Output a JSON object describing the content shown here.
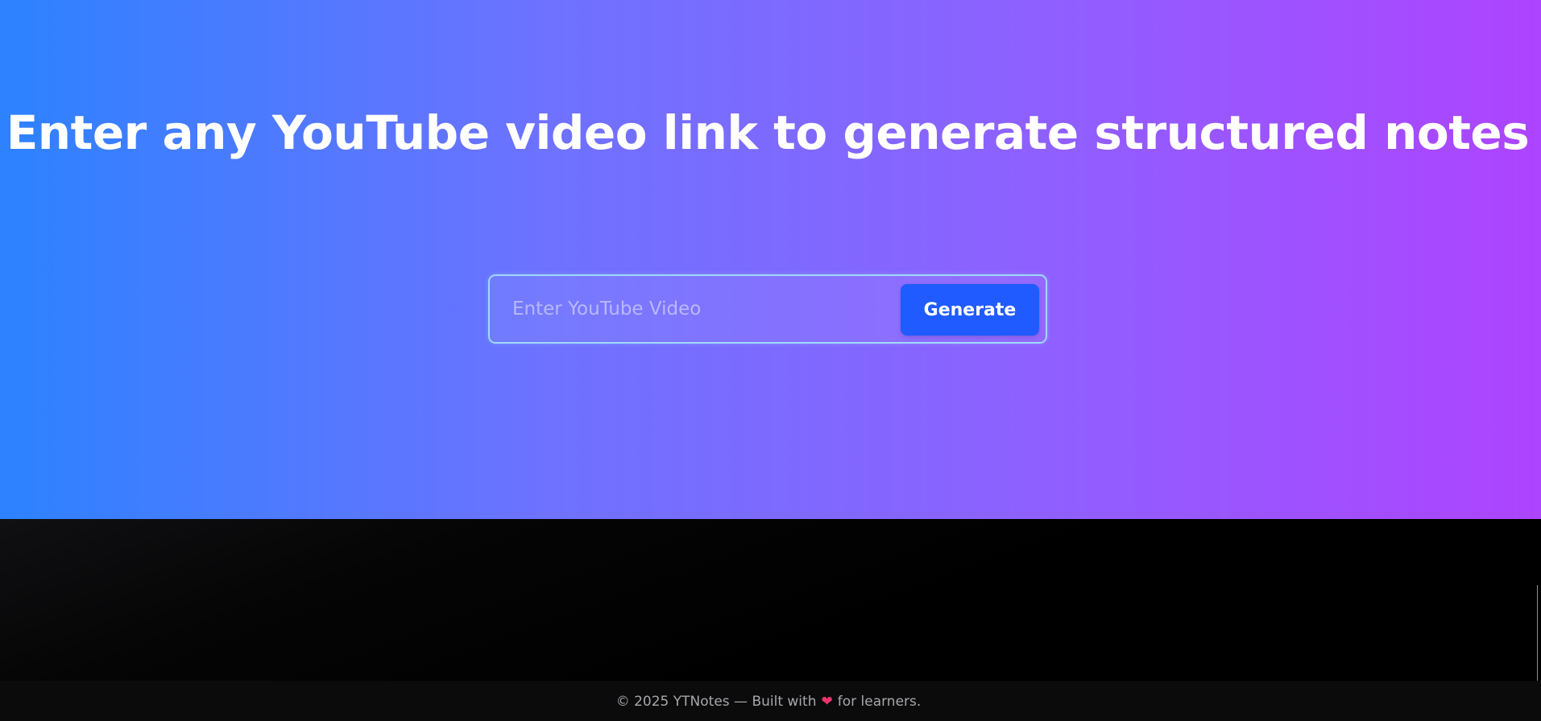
{
  "hero": {
    "headline": "Enter any YouTube video link to generate structured notes",
    "background_gradient": [
      "#2d82ff",
      "#ad44ff"
    ]
  },
  "search": {
    "placeholder": "Enter YouTube Video",
    "value": "",
    "button_label": "Generate",
    "button_color": "#1f5bff"
  },
  "footer": {
    "text_before": "© 2025 YTNotes — Built with",
    "icon": "heart-icon",
    "text_after": "for learners.",
    "heart_color": "#f0356b"
  }
}
